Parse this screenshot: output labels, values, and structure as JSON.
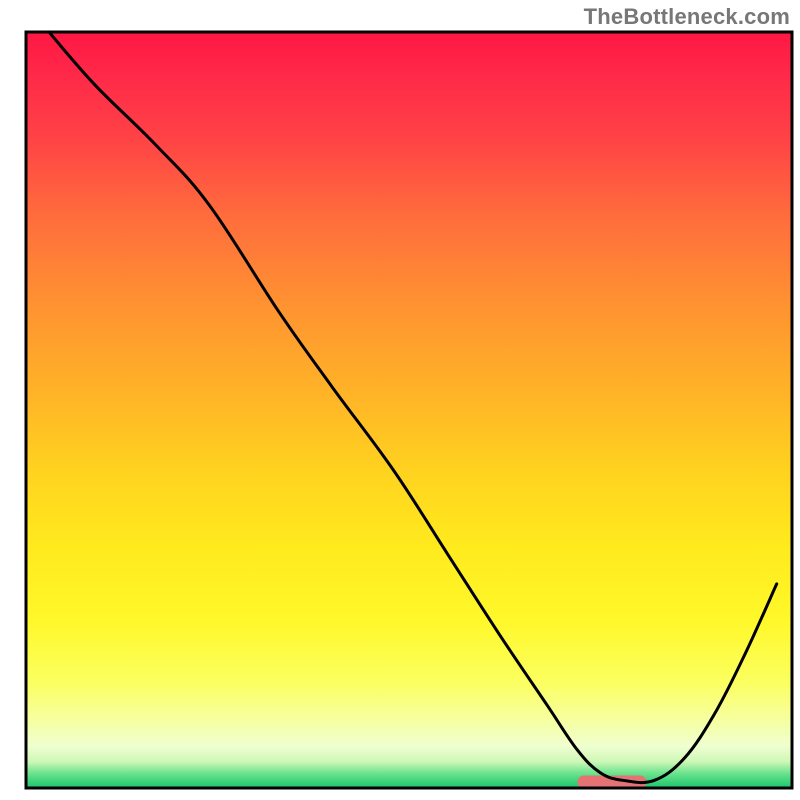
{
  "watermark": "TheBottleneck.com",
  "chart_data": {
    "type": "line",
    "title": "",
    "xlabel": "",
    "ylabel": "",
    "xlim": [
      0,
      100
    ],
    "ylim": [
      0,
      100
    ],
    "x": [
      3,
      9,
      17,
      24,
      33,
      40,
      48,
      55,
      62,
      68,
      72,
      75,
      78,
      82,
      86,
      90,
      94,
      98
    ],
    "y": [
      100,
      93,
      85,
      77,
      63,
      53,
      42,
      31,
      20,
      11,
      5,
      2,
      1,
      1,
      4,
      10,
      18,
      27
    ],
    "marker": {
      "x_start": 72,
      "x_end": 81,
      "y": 0.8,
      "color": "#e57373"
    },
    "gradient_stops": [
      {
        "offset": 0.0,
        "color": "#ff1744"
      },
      {
        "offset": 0.06,
        "color": "#ff2a49"
      },
      {
        "offset": 0.14,
        "color": "#ff4246"
      },
      {
        "offset": 0.24,
        "color": "#ff6b3d"
      },
      {
        "offset": 0.36,
        "color": "#ff9231"
      },
      {
        "offset": 0.48,
        "color": "#ffb427"
      },
      {
        "offset": 0.58,
        "color": "#ffd21f"
      },
      {
        "offset": 0.68,
        "color": "#ffea1e"
      },
      {
        "offset": 0.78,
        "color": "#fff82a"
      },
      {
        "offset": 0.86,
        "color": "#fbff60"
      },
      {
        "offset": 0.91,
        "color": "#f6ffa0"
      },
      {
        "offset": 0.945,
        "color": "#efffd0"
      },
      {
        "offset": 0.965,
        "color": "#cef7b7"
      },
      {
        "offset": 0.98,
        "color": "#6ee38f"
      },
      {
        "offset": 1.0,
        "color": "#19c66b"
      }
    ],
    "frame_color": "#000000",
    "curve_color": "#000000"
  }
}
